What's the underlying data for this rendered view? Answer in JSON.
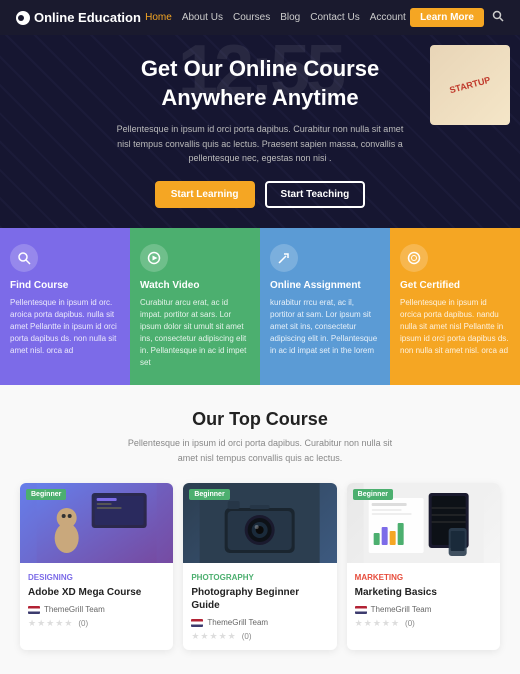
{
  "navbar": {
    "logo": "Online Education",
    "logo_icon": "●",
    "links": [
      {
        "label": "Home",
        "active": true
      },
      {
        "label": "About Us",
        "active": false
      },
      {
        "label": "Courses",
        "active": false
      },
      {
        "label": "Blog",
        "active": false
      },
      {
        "label": "Contact Us",
        "active": false
      },
      {
        "label": "Account",
        "active": false
      }
    ],
    "learn_more": "Learn More",
    "search_icon": "🔍"
  },
  "hero": {
    "clock": "12:55",
    "title": "Get Our Online Course\nAnywhere Anytime",
    "subtitle": "Pellentesque in ipsum id orci porta dapibus. Curabitur non nulla sit amet nisl tempus convallis quis ac lectus. Praesent sapien massa, convallis a pellentesque nec, egestas non nisi .",
    "btn_primary": "Start Learning",
    "btn_secondary": "Start Teaching"
  },
  "features": [
    {
      "icon": "🔍",
      "title": "Find Course",
      "text": "Pellentesque in ipsum id orc. aroica porta dapibus. nulla sit amet Pellantte in ipsum id orci porta dapibus ds. non nulla sit amet nisl. orca ad"
    },
    {
      "icon": "▶",
      "title": "Watch Video",
      "text": "Curabitur arcu erat, ac id impat. portitor at sars. Lor ipsum dolor sit umult sit amet ins, consectetur adipiscing elit in. Pellantesque in ac id impet set"
    },
    {
      "icon": "✎",
      "title": "Online Assignment",
      "text": "kurabitur rrcu erat, ac il, portitor at sam. Lor ipsum sit amet sit ins, consectetur adipiscing elit in. Pellantesque in ac id impat set in the lorem"
    },
    {
      "icon": "◎",
      "title": "Get Certified",
      "text": "Pellentesque in ipsum id orcica porta dapibus. nandu nulla sit amet nisl Pellantte in ipsum id orci porta dapibus ds. non nulla sit amet nisl. orca ad"
    }
  ],
  "top_course": {
    "title": "Our Top Course",
    "subtitle": "Pellentesque in ipsum id orci porta dapibus. Curabitur non nulla sit amet nisl tempus convallis quis ac lectus.",
    "courses": [
      {
        "badge": "Beginner",
        "category": "DESIGNING",
        "category_class": "cat-design",
        "name": "Adobe XD Mega Course",
        "team": "ThemeGrill Team",
        "rating": 0,
        "rating_count": "(0)",
        "thumb_type": "design"
      },
      {
        "badge": "Beginner",
        "category": "PHOTOGRAPHY",
        "category_class": "cat-photo",
        "name": "Photography Beginner Guide",
        "team": "ThemeGrill Team",
        "rating": 0,
        "rating_count": "(0)",
        "thumb_type": "photo"
      },
      {
        "badge": "Beginner",
        "category": "MARKETING",
        "category_class": "cat-marketing",
        "name": "Marketing Basics",
        "team": "ThemeGrill Team",
        "rating": 0,
        "rating_count": "(0)",
        "thumb_type": "marketing"
      }
    ]
  }
}
